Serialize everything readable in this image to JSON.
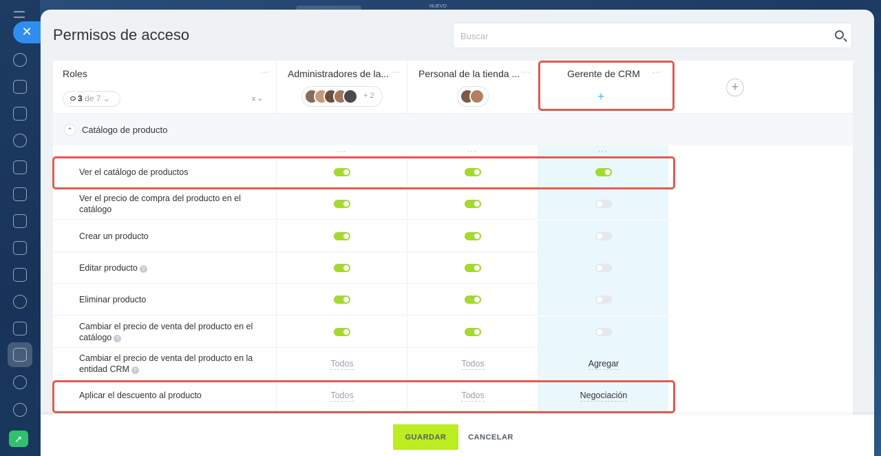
{
  "topbar": {
    "new_label": "NUEVO"
  },
  "sidebar": {
    "icons": [
      "chat-icon",
      "comments-icon",
      "feed-icon",
      "settings-hex-icon",
      "calendar-icon",
      "document-icon",
      "presentation-icon",
      "card-icon",
      "mail-icon",
      "users-icon",
      "tasks-icon",
      "filter-icon",
      "robot-icon",
      "gear-icon",
      "rocket-icon"
    ]
  },
  "header": {
    "title": "Permisos de acceso",
    "search_placeholder": "Buscar"
  },
  "roles": {
    "title": "Roles",
    "count": "3",
    "of_label": "de 7"
  },
  "columns": [
    {
      "title": "Administradores de la...",
      "avatars_extra": "+ 2"
    },
    {
      "title": "Personal de la tienda ..."
    },
    {
      "title": "Gerente de CRM"
    }
  ],
  "section": {
    "label": "Catálogo de producto"
  },
  "permissions": [
    {
      "label": "Ver el catálogo de productos",
      "values": [
        "on",
        "on",
        "on"
      ]
    },
    {
      "label": "Ver el precio de compra del producto en el catálogo",
      "values": [
        "on",
        "on",
        "off"
      ]
    },
    {
      "label": "Crear un producto",
      "values": [
        "on",
        "on",
        "off"
      ]
    },
    {
      "label": "Editar producto",
      "values": [
        "on",
        "on",
        "off"
      ]
    },
    {
      "label": "Eliminar producto",
      "values": [
        "on",
        "on",
        "off"
      ]
    },
    {
      "label": "Cambiar el precio de venta del producto en el catálogo",
      "values": [
        "on",
        "on",
        "off"
      ]
    },
    {
      "label": "Cambiar el precio de venta del producto en la entidad CRM",
      "values": [
        "Todos",
        "Todos",
        "Agregar"
      ]
    },
    {
      "label": "Aplicar el descuento al producto",
      "values": [
        "Todos",
        "Todos",
        "Negociación"
      ]
    }
  ],
  "footer": {
    "save_label": "GUARDAR",
    "cancel_label": "CANCELAR"
  },
  "colors": {
    "toggle_on": "#a4d931",
    "save_button": "#bbed21",
    "highlight_col": "#eaf7fd",
    "annotation_red": "#e55a4e"
  }
}
